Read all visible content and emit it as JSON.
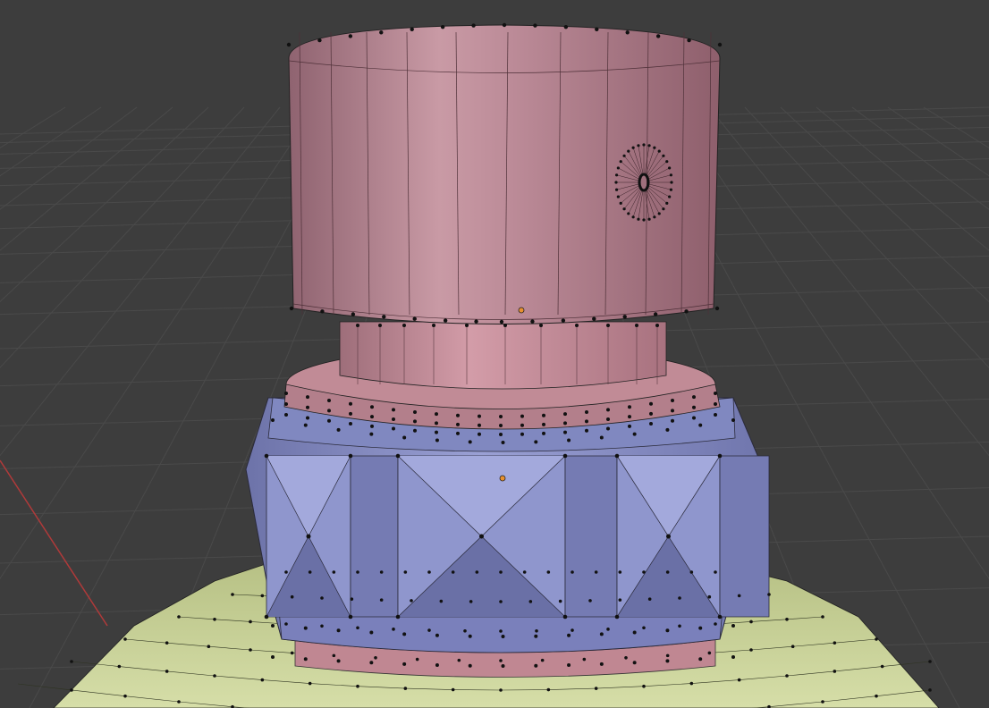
{
  "viewport": {
    "background": "#3d3d3d",
    "grid_color": "#4a4a4a",
    "x_axis_color": "#b03a3a"
  },
  "materials": {
    "top_cylinder": "#b8838f",
    "neck": "#c48f9b",
    "blue_ring": "#8d93c8",
    "blue_dark": "#6c72a8",
    "lower_pink": "#c08792",
    "base_green": "#c9d39a",
    "base_green_dark": "#9aa56f",
    "vertex": "#111111",
    "origin_marker": "#e8902f"
  }
}
